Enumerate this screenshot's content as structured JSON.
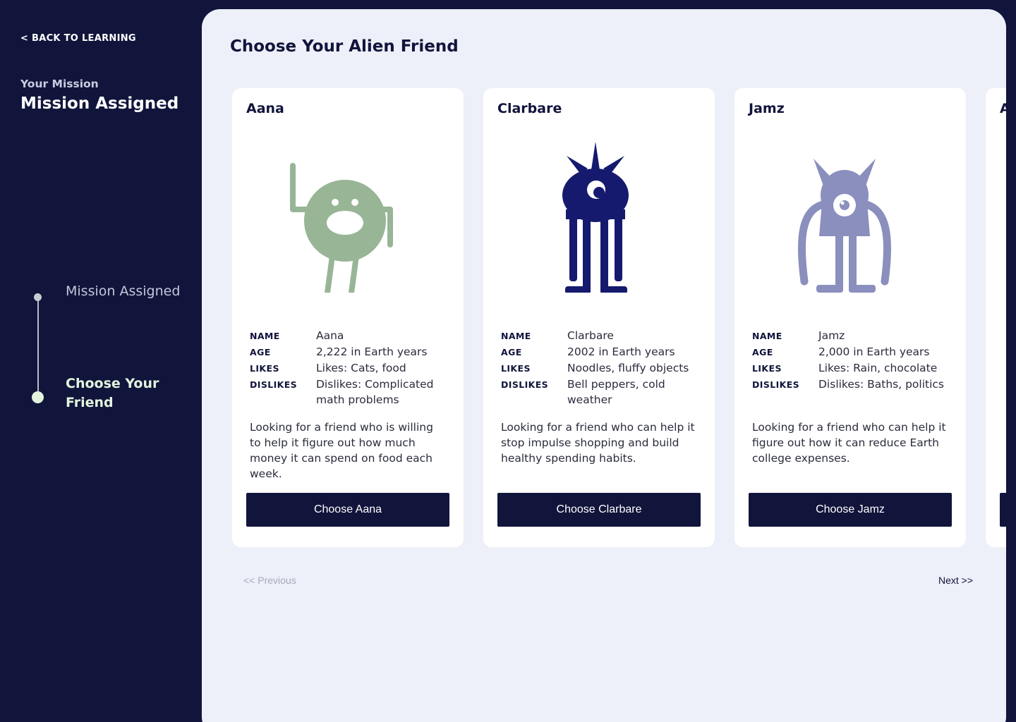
{
  "sidebar": {
    "back_label": "< BACK TO LEARNING",
    "mission_label": "Your Mission",
    "mission_title": "Mission Assigned",
    "steps": [
      {
        "label": "Mission Assigned",
        "state": "completed"
      },
      {
        "label": "Choose Your Friend",
        "state": "active"
      }
    ]
  },
  "main": {
    "title": "Choose Your Alien Friend",
    "field_labels": {
      "name": "NAME",
      "age": "AGE",
      "likes": "LIKES",
      "dislikes": "DISLIKES"
    },
    "cards": [
      {
        "name": "Aana",
        "art_icon": "green-round-alien-icon",
        "age": "2,222 in Earth years",
        "likes": "Likes: Cats, food",
        "dislikes": "Dislikes: Complicated math problems",
        "description": "Looking for a friend who is willing to help it figure out how much money it can spend on food each week.",
        "button": "Choose Aana",
        "color": "#98b596"
      },
      {
        "name": "Clarbare",
        "art_icon": "navy-spiky-alien-icon",
        "age": "2002 in Earth years",
        "likes": "Noodles, fluffy objects",
        "dislikes": "Bell peppers, cold weather",
        "description": "Looking for a friend who can help it stop impulse shopping and build healthy spending habits.",
        "button": "Choose Clarbare",
        "color": "#151a6e"
      },
      {
        "name": "Jamz",
        "art_icon": "purple-horned-alien-icon",
        "age": "2,000 in Earth years",
        "likes": "Likes: Rain, chocolate",
        "dislikes": "Dislikes: Baths, politics",
        "description": "Looking for a friend who can help it figure out how it can reduce Earth college expenses.",
        "button": "Choose Jamz",
        "color": "#8a8fbd"
      }
    ],
    "pagination": {
      "previous": "<< Previous",
      "next": "Next >>"
    }
  },
  "colors": {
    "sidebar_bg": "#11143b",
    "panel_bg": "#edf0f8",
    "active_step": "#e3f3dd",
    "button_bg": "#11143b"
  }
}
